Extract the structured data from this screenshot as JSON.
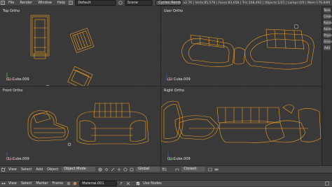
{
  "topbar": {
    "menus": [
      "File",
      "Render",
      "Window",
      "Help"
    ],
    "layout": "Default",
    "scene": "Scene",
    "engine": "Cycles Render",
    "stats": "v2.76 | Verts:85,578 | Faces:83,658 | Tris:168,492 | Objects:1/21 | Lamps:0/0 | Mem:176.84M"
  },
  "viewports": {
    "top_left": {
      "label": "Top Ortho",
      "object": "(1) Cube.009"
    },
    "top_right": {
      "label": "User Ortho",
      "object": "(1) Cube.009"
    },
    "bottom_left": {
      "label": "Front Ortho",
      "object": "(1) Cube.009"
    },
    "bottom_right": {
      "label": "Right Ortho",
      "object": "(1) Cube.009"
    }
  },
  "sidebar": {
    "tabs": [
      "Tools",
      "Create",
      "Relations",
      "Animation",
      "Physics",
      "Grease",
      "Add"
    ]
  },
  "viewport_header": {
    "menus": [
      "View",
      "Select",
      "Add",
      "Object"
    ],
    "mode": "Object Mode",
    "pivot": "Global",
    "snap": "Closest"
  },
  "statusbar": {
    "menus": [
      "View",
      "Select",
      "Marker",
      "Frame"
    ],
    "material": "Material.001",
    "use_nodes": "Use Nodes"
  },
  "colors": {
    "wire": "#f5a020",
    "bg": "#393939",
    "header": "#474747"
  }
}
